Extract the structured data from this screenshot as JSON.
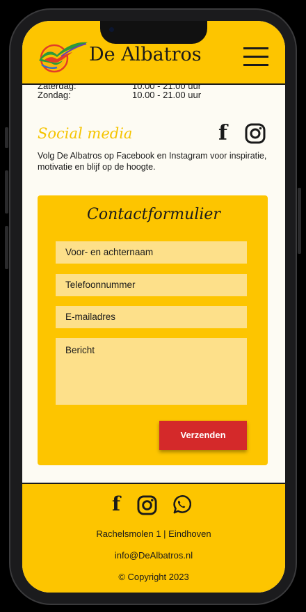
{
  "header": {
    "brand": "De Albatros",
    "logo_icon": "albatross-logo-icon",
    "menu_icon": "hamburger-menu-icon"
  },
  "opening_hours": [
    {
      "day": "Zaterdag:",
      "time": "10.00 - 21.00 uur"
    },
    {
      "day": "Zondag:",
      "time": "10.00 - 21.00 uur"
    }
  ],
  "social": {
    "title": "Social media",
    "description": "Volg De Albatros op Facebook en Instagram voor inspiratie, motivatie en blijf op de hoogte.",
    "icons": [
      "facebook-icon",
      "instagram-icon"
    ]
  },
  "contact_form": {
    "title": "Contactformulier",
    "name_placeholder": "Voor- en achternaam",
    "phone_placeholder": "Telefoonnummer",
    "email_placeholder": "E-mailadres",
    "message_placeholder": "Bericht",
    "submit_label": "Verzenden"
  },
  "footer": {
    "icons": [
      "facebook-icon",
      "instagram-icon",
      "whatsapp-icon"
    ],
    "address": "Rachelsmolen 1 | Eindhoven",
    "email": "info@DeAlbatros.nl",
    "copyright": "© Copyright 2023"
  },
  "colors": {
    "brand_yellow": "#fdc500",
    "field_yellow": "#fde08a",
    "button_red": "#d4292a",
    "page_background": "#fdfbf3",
    "text_dark": "#1a1a1a"
  }
}
